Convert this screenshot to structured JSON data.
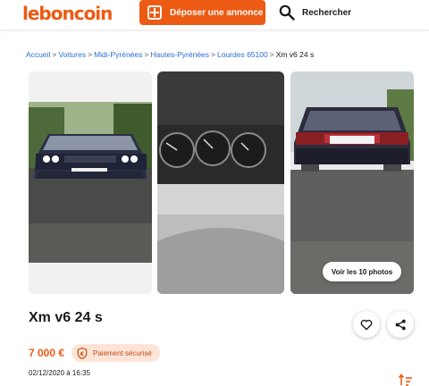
{
  "header": {
    "logo": "leboncoin",
    "post_ad_label": "Déposer une annonce",
    "search_label": "Rechercher"
  },
  "breadcrumb": {
    "items": [
      "Accueil",
      "Voitures",
      "Midi-Pyrénées",
      "Hautes-Pyrénées",
      "Lourdes 65100"
    ],
    "current": "Xm v6 24 s"
  },
  "gallery": {
    "photos": [
      {
        "icon": "car-front-photo"
      },
      {
        "icon": "dashboard-gauges-photo"
      },
      {
        "icon": "car-rear-photo"
      }
    ],
    "see_all_label": "Voir les 10 photos"
  },
  "listing": {
    "title": "Xm v6 24 s",
    "price": "7 000 €",
    "secure_payment_label": "Paiement sécurisé",
    "date": "02/12/2020 à 16:35"
  },
  "colors": {
    "brand": "#ec5a13",
    "link": "#2b6fd1",
    "secure_bg": "#fde4d7"
  }
}
